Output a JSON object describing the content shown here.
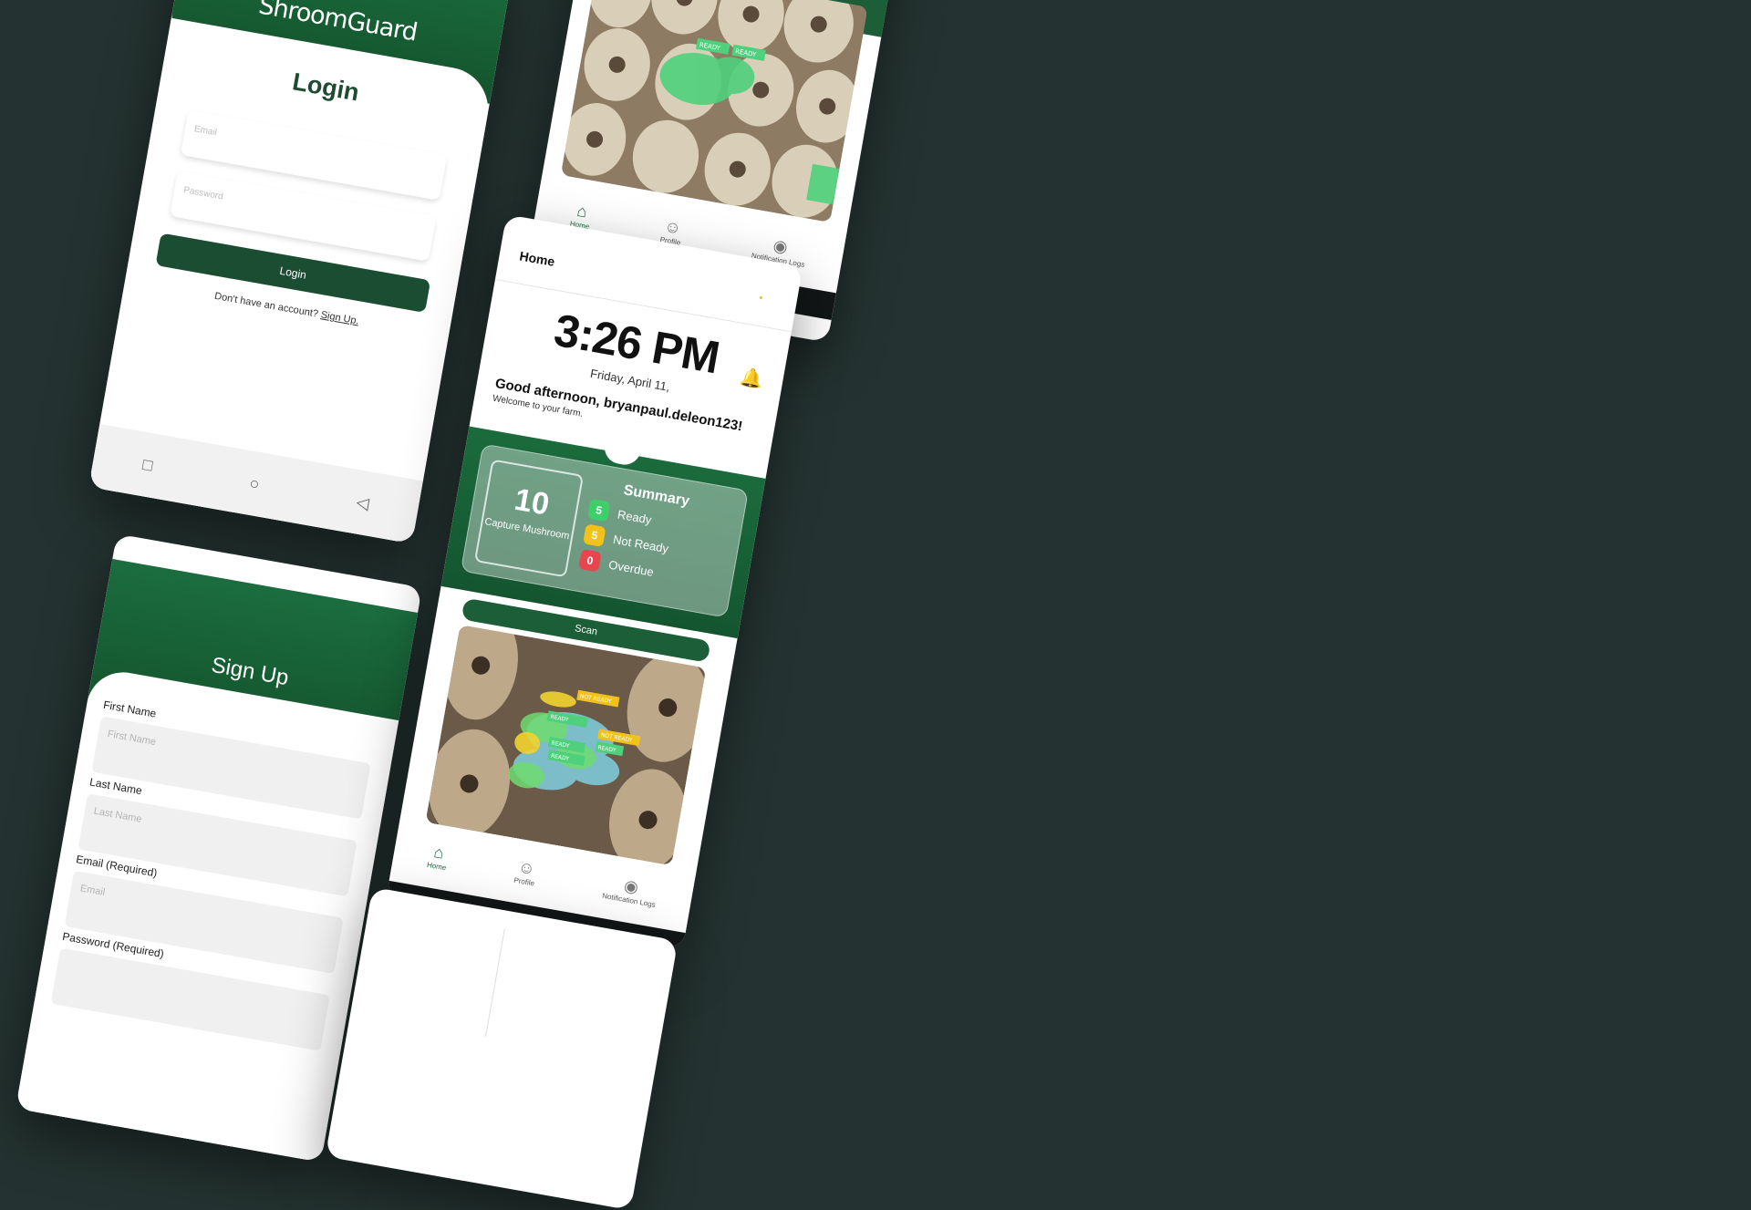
{
  "login": {
    "app_name": "ShroomGuard",
    "title": "Login",
    "email_placeholder": "Email",
    "password_placeholder": "Password",
    "login_button": "Login",
    "no_account_text": "Don't have an account?",
    "signup_link": "Sign Up."
  },
  "signup": {
    "title": "Sign Up",
    "fields": [
      {
        "label": "First Name",
        "placeholder": "First Name"
      },
      {
        "label": "Last Name",
        "placeholder": "Last Name"
      },
      {
        "label": "Email (Required)",
        "placeholder": "Email"
      },
      {
        "label": "Password (Required)",
        "placeholder": ""
      }
    ]
  },
  "home": {
    "header_title": "Home",
    "time": "3:26 PM",
    "date": "Friday, April 11,",
    "greeting": "Good afternoon, bryanpaul.deleon123!",
    "welcome": "Welcome to your farm.",
    "capture_count": "10",
    "capture_label": "Capture Mushroom",
    "summary_title": "Summary",
    "summary": [
      {
        "count": "5",
        "label": "Ready",
        "color": "#3fcf6a"
      },
      {
        "count": "5",
        "label": "Not Ready",
        "color": "#f2c21b"
      },
      {
        "count": "0",
        "label": "Overdue",
        "color": "#e8454e"
      }
    ],
    "scan_button": "Scan"
  },
  "bottom_nav": [
    {
      "label": "Home",
      "icon": "home-icon"
    },
    {
      "label": "Profile",
      "icon": "profile-icon"
    },
    {
      "label": "Notification Logs",
      "icon": "notification-icon"
    }
  ],
  "detections": {
    "top": [
      "READY",
      "READY"
    ],
    "home": [
      "NOT READY",
      "READY",
      "NOT READY",
      "READY",
      "READY",
      "READY"
    ]
  },
  "colors": {
    "background": "#243331",
    "brand_green": "#1b6d3f",
    "dark_green": "#1b4d33"
  }
}
